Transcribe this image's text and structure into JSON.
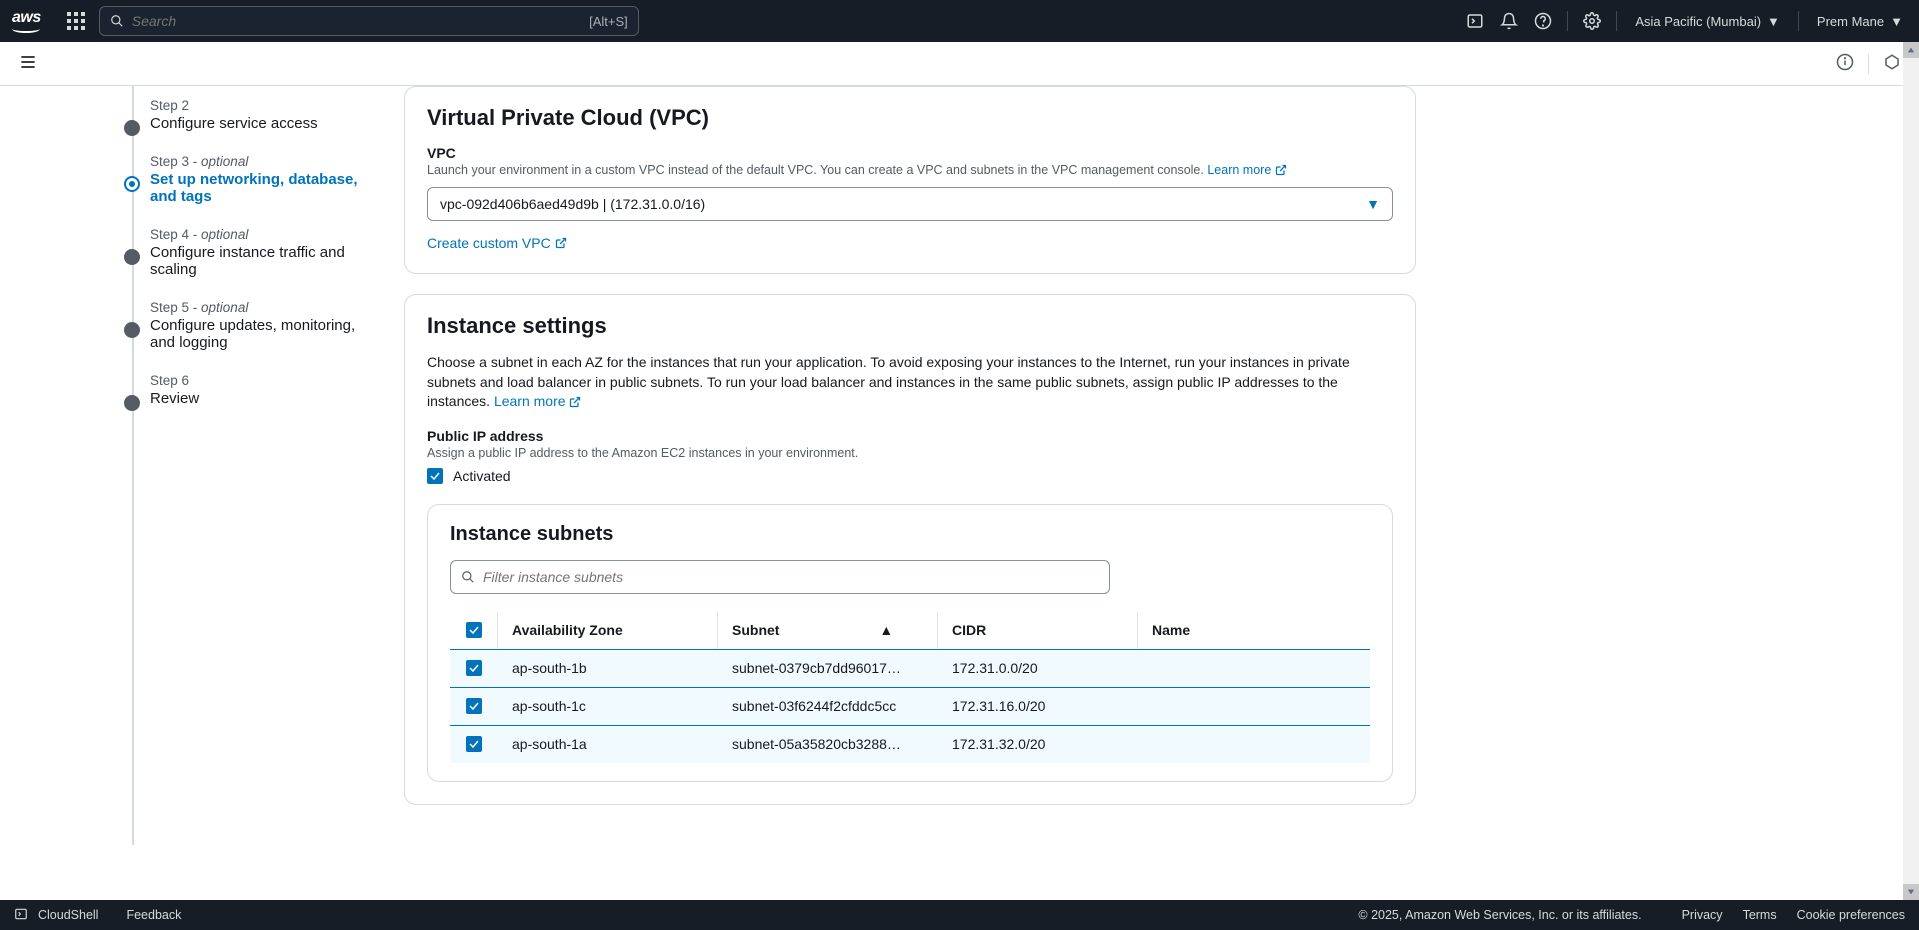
{
  "topnav": {
    "logo": "aws",
    "search_placeholder": "Search",
    "search_hint": "[Alt+S]",
    "region": "Asia Pacific (Mumbai)",
    "user": "Prem Mane"
  },
  "steps": [
    {
      "label": "Step 2",
      "optional": false,
      "title": "Configure service access",
      "active": false
    },
    {
      "label": "Step 3",
      "optional": true,
      "optional_text": "optional",
      "title": "Set up networking, database, and tags",
      "active": true
    },
    {
      "label": "Step 4",
      "optional": true,
      "optional_text": "optional",
      "title": "Configure instance traffic and scaling",
      "active": false
    },
    {
      "label": "Step 5",
      "optional": true,
      "optional_text": "optional",
      "title": "Configure updates, monitoring, and logging",
      "active": false
    },
    {
      "label": "Step 6",
      "optional": false,
      "title": "Review",
      "active": false
    }
  ],
  "vpc_section": {
    "heading": "Virtual Private Cloud (VPC)",
    "label": "VPC",
    "desc": "Launch your environment in a custom VPC instead of the default VPC. You can create a VPC and subnets in the VPC management console.",
    "learn_more": "Learn more",
    "selected": "vpc-092d406b6aed49d9b | (172.31.0.0/16)",
    "create_link": "Create custom VPC"
  },
  "instance_settings": {
    "heading": "Instance settings",
    "desc": "Choose a subnet in each AZ for the instances that run your application. To avoid exposing your instances to the Internet, run your instances in private subnets and load balancer in public subnets. To run your load balancer and instances in the same public subnets, assign public IP addresses to the instances.",
    "learn_more": "Learn more",
    "pubip_label": "Public IP address",
    "pubip_desc": "Assign a public IP address to the Amazon EC2 instances in your environment.",
    "pubip_checkbox": "Activated",
    "subnets_heading": "Instance subnets",
    "filter_placeholder": "Filter instance subnets",
    "columns": {
      "az": "Availability Zone",
      "subnet": "Subnet",
      "cidr": "CIDR",
      "name": "Name"
    },
    "rows": [
      {
        "az": "ap-south-1b",
        "subnet": "subnet-0379cb7dd96017…",
        "cidr": "172.31.0.0/20",
        "name": ""
      },
      {
        "az": "ap-south-1c",
        "subnet": "subnet-03f6244f2cfddc5cc",
        "cidr": "172.31.16.0/20",
        "name": ""
      },
      {
        "az": "ap-south-1a",
        "subnet": "subnet-05a35820cb3288…",
        "cidr": "172.31.32.0/20",
        "name": ""
      }
    ]
  },
  "footer": {
    "cloudshell": "CloudShell",
    "feedback": "Feedback",
    "copyright": "© 2025, Amazon Web Services, Inc. or its affiliates.",
    "privacy": "Privacy",
    "terms": "Terms",
    "cookies": "Cookie preferences"
  }
}
